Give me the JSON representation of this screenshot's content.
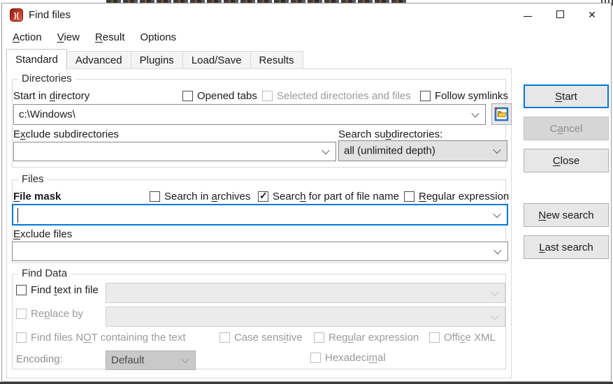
{
  "window": {
    "title": "Find files"
  },
  "titlebar": {
    "close_glyph": "✕"
  },
  "menu": {
    "items": [
      {
        "text": "Action",
        "accel": 0
      },
      {
        "text": "View",
        "accel": 0
      },
      {
        "text": "Result",
        "accel": 0
      },
      {
        "text": "Options",
        "accel": -1
      }
    ]
  },
  "tabs": {
    "active": "Standard",
    "items": [
      {
        "label": "Standard"
      },
      {
        "label": "Advanced"
      },
      {
        "label": "Plugins"
      },
      {
        "label": "Load/Save"
      },
      {
        "label": "Results"
      }
    ]
  },
  "directories": {
    "legend": "Directories",
    "start_in_directory_label": {
      "text": "Start in directory",
      "accel": 9
    },
    "opened_tabs": {
      "text": "Opened tabs",
      "accel": -1,
      "checked": false
    },
    "selected_dirs": {
      "text": "Selected directories and files",
      "accel": -1,
      "checked": false
    },
    "follow_symlinks": {
      "text": "Follow symlinks",
      "accel": -1,
      "checked": false
    },
    "start_directory_value": "c:\\Windows\\",
    "exclude_subdirectories_label": {
      "text": "Exclude subdirectories",
      "accel": 1
    },
    "exclude_subdirectories_value": "",
    "search_subdirectories_label": {
      "text": "Search subdirectories:",
      "accel": 9
    },
    "search_subdirectories_value": "all (unlimited depth)"
  },
  "files": {
    "legend": "Files",
    "file_mask_label": {
      "text": "File mask",
      "accel": 0
    },
    "search_in_archives": {
      "text": "Search in archives",
      "accel": 10,
      "checked": false
    },
    "search_part_of_name": {
      "text": "Search for part of file name",
      "accel": 5,
      "checked": true
    },
    "regular_expression": {
      "text": "Regular expression",
      "accel": 0,
      "checked": false
    },
    "file_mask_value": "",
    "exclude_files_label": {
      "text": "Exclude files",
      "accel": 0
    },
    "exclude_files_value": ""
  },
  "find_data": {
    "legend": "Find Data",
    "find_text_in_file": {
      "text": "Find text in file",
      "accel": 5,
      "checked": false
    },
    "find_text_value": "",
    "replace_by": {
      "text": "Replace by",
      "accel": 2,
      "checked": false
    },
    "replace_value": "",
    "not_containing": {
      "text": "Find files NOT containing the text",
      "accel": 12,
      "checked": false
    },
    "case_sensitive": {
      "text": "Case sensitive",
      "accel": 9,
      "checked": false
    },
    "regular_expression": {
      "text": "Regular expression",
      "accel": 3,
      "checked": false
    },
    "office_xml": {
      "text": "Office XML",
      "accel": 4,
      "checked": false
    },
    "encoding_label": {
      "text": "Encoding:",
      "accel": 7
    },
    "encoding_value": "Default",
    "hexadecimal": {
      "text": "Hexadecimal",
      "accel": 8,
      "checked": false
    }
  },
  "buttons": {
    "start": {
      "text": "Start",
      "accel": 0
    },
    "cancel": {
      "text": "Cancel",
      "accel": 1
    },
    "close": {
      "text": "Close",
      "accel": 0
    },
    "new_search": {
      "text": "New search",
      "accel": 0
    },
    "last_search": {
      "text": "Last search",
      "accel": 0
    }
  },
  "colors": {
    "accent": "#0078d7",
    "logo_red": "#c23b22"
  }
}
